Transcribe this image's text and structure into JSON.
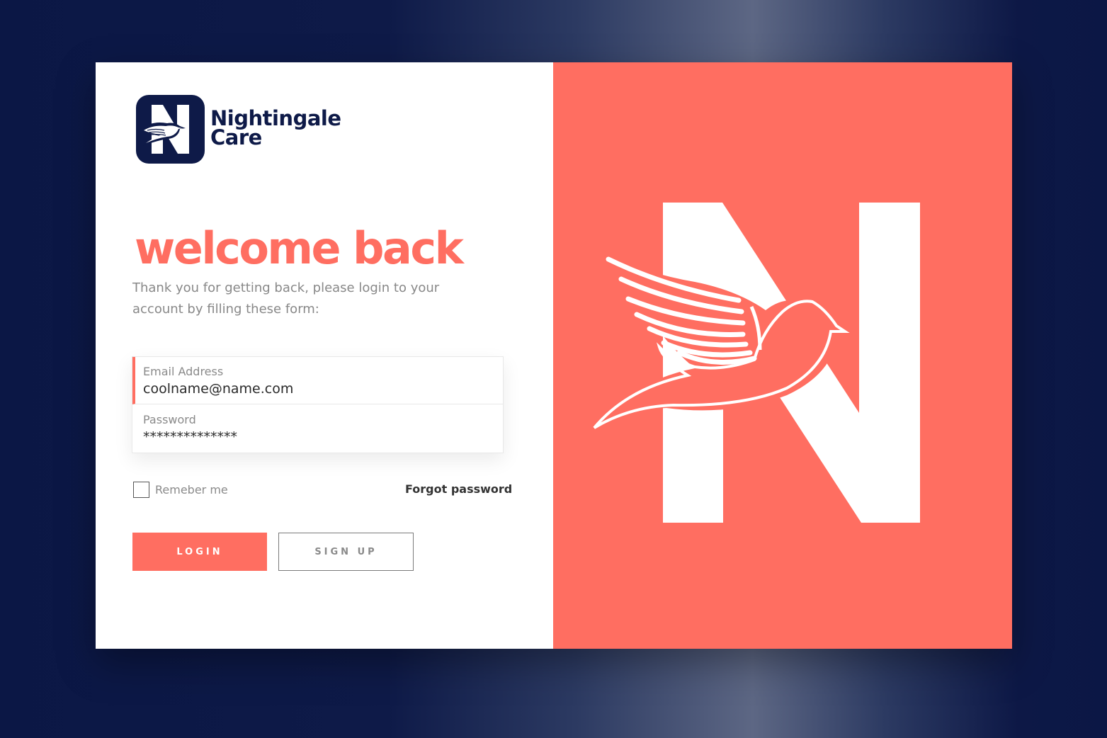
{
  "brand": {
    "name_line1": "Nightingale",
    "name_line2": "Care",
    "logo_icon": "nightingale-n-bird-logo",
    "colors": {
      "navy": "#0e1a48",
      "coral": "#ff6e61",
      "white": "#ffffff"
    }
  },
  "login": {
    "heading": "welcome back",
    "subtitle": "Thank you for getting back, please login to your account by filling these form:",
    "email": {
      "label": "Email Address",
      "value": "coolname@name.com"
    },
    "password": {
      "label": "Password",
      "value": "**************"
    },
    "remember_label": "Remeber me",
    "remember_checked": false,
    "forgot_label": "Forgot password",
    "login_button": "LOGIN",
    "signup_button": "SIGN UP"
  },
  "hero": {
    "illustration": "large-n-with-bird-logo"
  }
}
